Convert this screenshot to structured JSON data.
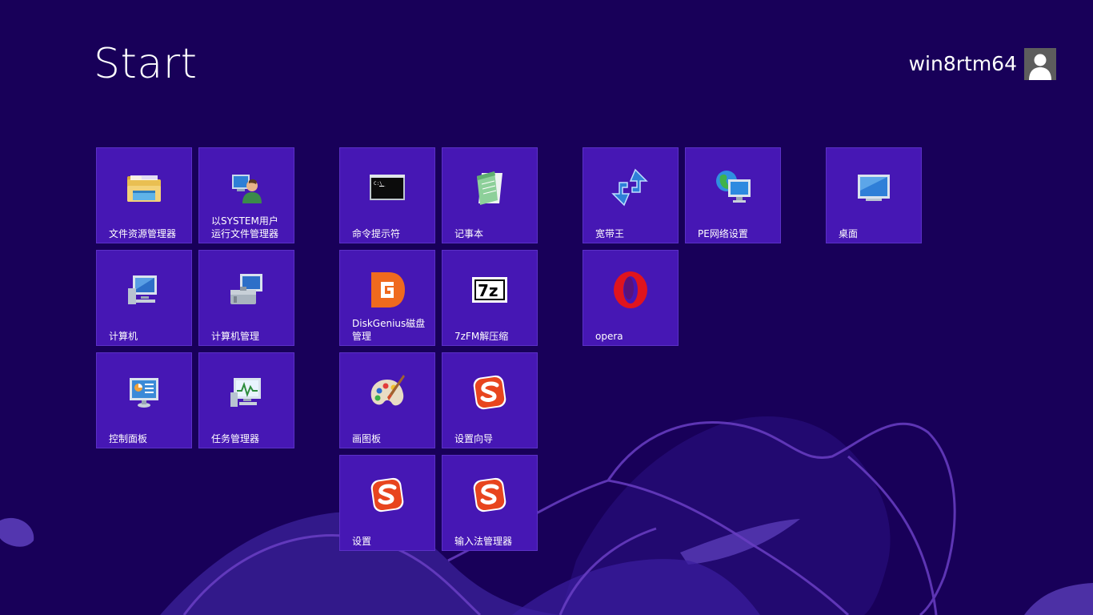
{
  "start": {
    "title": "Start"
  },
  "user": {
    "name": "win8rtm64",
    "avatar_icon": "user-avatar-icon"
  },
  "colors": {
    "background": "#180059",
    "tile": "#4617b4",
    "tile_border": "#5b30c6",
    "swirl": "#6a3fc4"
  },
  "groups": [
    {
      "tiles": [
        {
          "label": "文件资源管理器",
          "icon": "folder-explorer-icon"
        },
        {
          "label": "以SYSTEM用户\n运行文件管理器",
          "icon": "user-computer-icon"
        },
        {
          "label": "计算机",
          "icon": "computer-icon"
        },
        {
          "label": "计算机管理",
          "icon": "computer-management-icon"
        },
        {
          "label": "控制面板",
          "icon": "control-panel-icon"
        },
        {
          "label": "任务管理器",
          "icon": "task-manager-icon"
        }
      ]
    },
    {
      "tiles": [
        {
          "label": "命令提示符",
          "icon": "command-prompt-icon"
        },
        {
          "label": "记事本",
          "icon": "notepad-icon"
        },
        {
          "label": "DiskGenius磁盘\n管理",
          "icon": "diskgenius-icon"
        },
        {
          "label": "7zFM解压缩",
          "icon": "7zip-icon"
        },
        {
          "label": "画图板",
          "icon": "paint-palette-icon"
        },
        {
          "label": "设置向导",
          "icon": "sogou-icon"
        },
        {
          "label": "设置",
          "icon": "sogou-icon"
        },
        {
          "label": "输入法管理器",
          "icon": "sogou-icon"
        }
      ]
    },
    {
      "tiles": [
        {
          "label": "宽带王",
          "icon": "broadband-arrows-icon"
        },
        {
          "label": "PE网络设置",
          "icon": "network-globe-icon"
        },
        {
          "label": "opera",
          "icon": "opera-icon"
        }
      ]
    },
    {
      "tiles": [
        {
          "label": "桌面",
          "icon": "desktop-monitor-icon"
        }
      ]
    }
  ]
}
